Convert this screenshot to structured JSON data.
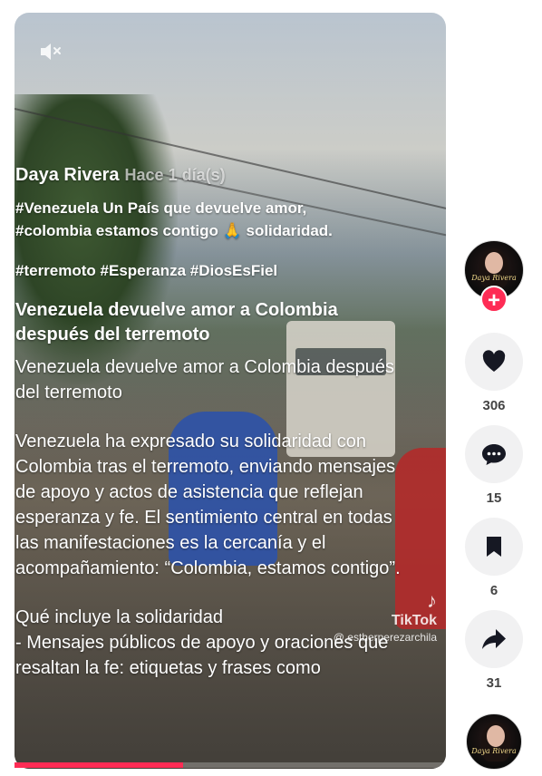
{
  "video": {
    "mute_icon": "muted-speaker-icon",
    "author": "Daya Rivera",
    "posted": "Hace 1 día(s)",
    "tags_line1": "#Venezuela Un País que devuelve amor,",
    "tags_line2": "#colombia  estamos contigo 🙏 solidaridad.",
    "tags_line3": "#terremoto #Esperanza #DiosEsFiel",
    "headline": "Venezuela devuelve amor a Colombia después del terremoto",
    "subtitle": "Venezuela devuelve amor a Colombia después del terremoto",
    "paragraph": "Venezuela ha expresado su solidaridad con Colombia tras el terremoto, enviando mensajes de apoyo y actos de asistencia que reflejan esperanza y fe. El sentimiento central en todas las manifestaciones es la cercanía y el acompañamiento: “Colombia, estamos contigo”.",
    "section_title": "Qué incluye la solidaridad",
    "section_item": "- Mensajes públicos de apoyo y oraciones que resaltan la fe: etiquetas y frases como",
    "watermark_brand": "TikTok",
    "watermark_user": "@ estherperezarchila",
    "progress": 0.39
  },
  "actions": {
    "avatar_name": "Daya Rivera",
    "follow_label": "+",
    "likes": "306",
    "comments": "15",
    "saves": "6",
    "shares": "31"
  },
  "colors": {
    "accent": "#fe2c55",
    "button_bg": "#f1f1f2",
    "icon": "#161823"
  }
}
